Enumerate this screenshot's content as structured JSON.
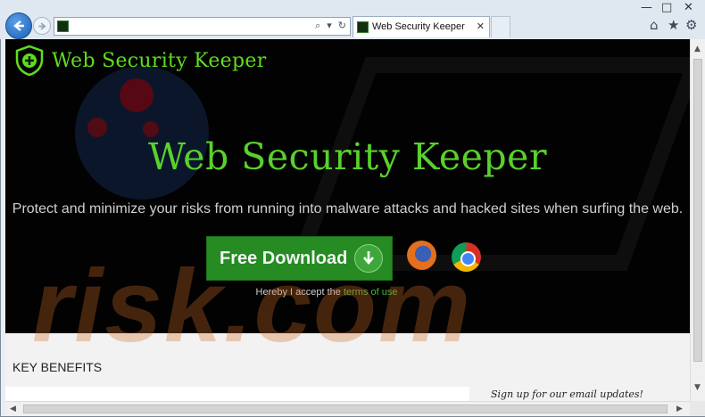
{
  "browser": {
    "address_value": "",
    "tab_title": "Web Security Keeper",
    "back_icon": "back-arrow-icon",
    "forward_icon": "forward-arrow-icon",
    "minimize_glyph": "—",
    "maximize_glyph": "□",
    "close_glyph": "✕",
    "tab_close_glyph": "✕",
    "search_glyph": "⌕",
    "dropdown_glyph": "▾",
    "refresh_glyph": "↻",
    "home_glyph": "⌂",
    "favorites_glyph": "★",
    "settings_glyph": "⚙"
  },
  "page": {
    "logo_text": "Web Security Keeper",
    "hero_title": "Web Security Keeper",
    "hero_subtitle": "Protect and minimize your risks from running into malware attacks and hacked sites when surfing the web.",
    "download_label": "Free Download",
    "accept_prefix": "Hereby I accept the ",
    "terms_link": "terms of use",
    "benefits_heading": "KEY BENEFITS",
    "signup_text": "Sign up for our email updates!",
    "watermark": "risk.com"
  },
  "colors": {
    "brand_green": "#5fdd1f",
    "button_green": "#258b22",
    "hero_bg": "#020202"
  }
}
